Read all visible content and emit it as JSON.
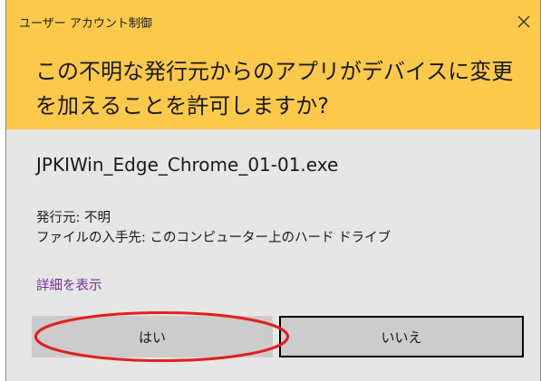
{
  "dialog": {
    "caption": "ユーザー アカウント制御",
    "question": "この不明な発行元からのアプリがデバイスに変更を加えることを許可しますか?",
    "filename": "JPKIWin_Edge_Chrome_01-01.exe",
    "publisher": "発行元: 不明",
    "source": "ファイルの入手先: このコンピューター上のハード ドライブ",
    "details_link": "詳細を表示",
    "yes_label": "はい",
    "no_label": "いいえ"
  },
  "colors": {
    "header": "#fdc94b",
    "body": "#e6e6e6",
    "button": "#cccccc",
    "link": "#7a3099",
    "annotation": "#e0201c"
  },
  "icons": {
    "close": "close-icon"
  }
}
